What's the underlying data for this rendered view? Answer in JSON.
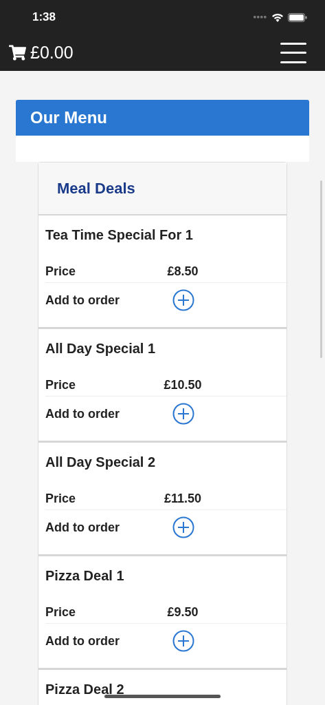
{
  "status_bar": {
    "time": "1:38"
  },
  "nav": {
    "cart_total": "£0.00"
  },
  "panel": {
    "title": "Our Menu"
  },
  "section": {
    "title": "Meal Deals"
  },
  "items": [
    {
      "name": "Tea Time Special For 1",
      "price_label": "Price",
      "price": "£8.50",
      "add_label": "Add to order"
    },
    {
      "name": "All Day Special 1",
      "price_label": "Price",
      "price": "£10.50",
      "add_label": "Add to order"
    },
    {
      "name": "All Day Special 2",
      "price_label": "Price",
      "price": "£11.50",
      "add_label": "Add to order"
    },
    {
      "name": "Pizza Deal 1",
      "price_label": "Price",
      "price": "£9.50",
      "add_label": "Add to order"
    },
    {
      "name": "Pizza Deal 2"
    }
  ]
}
